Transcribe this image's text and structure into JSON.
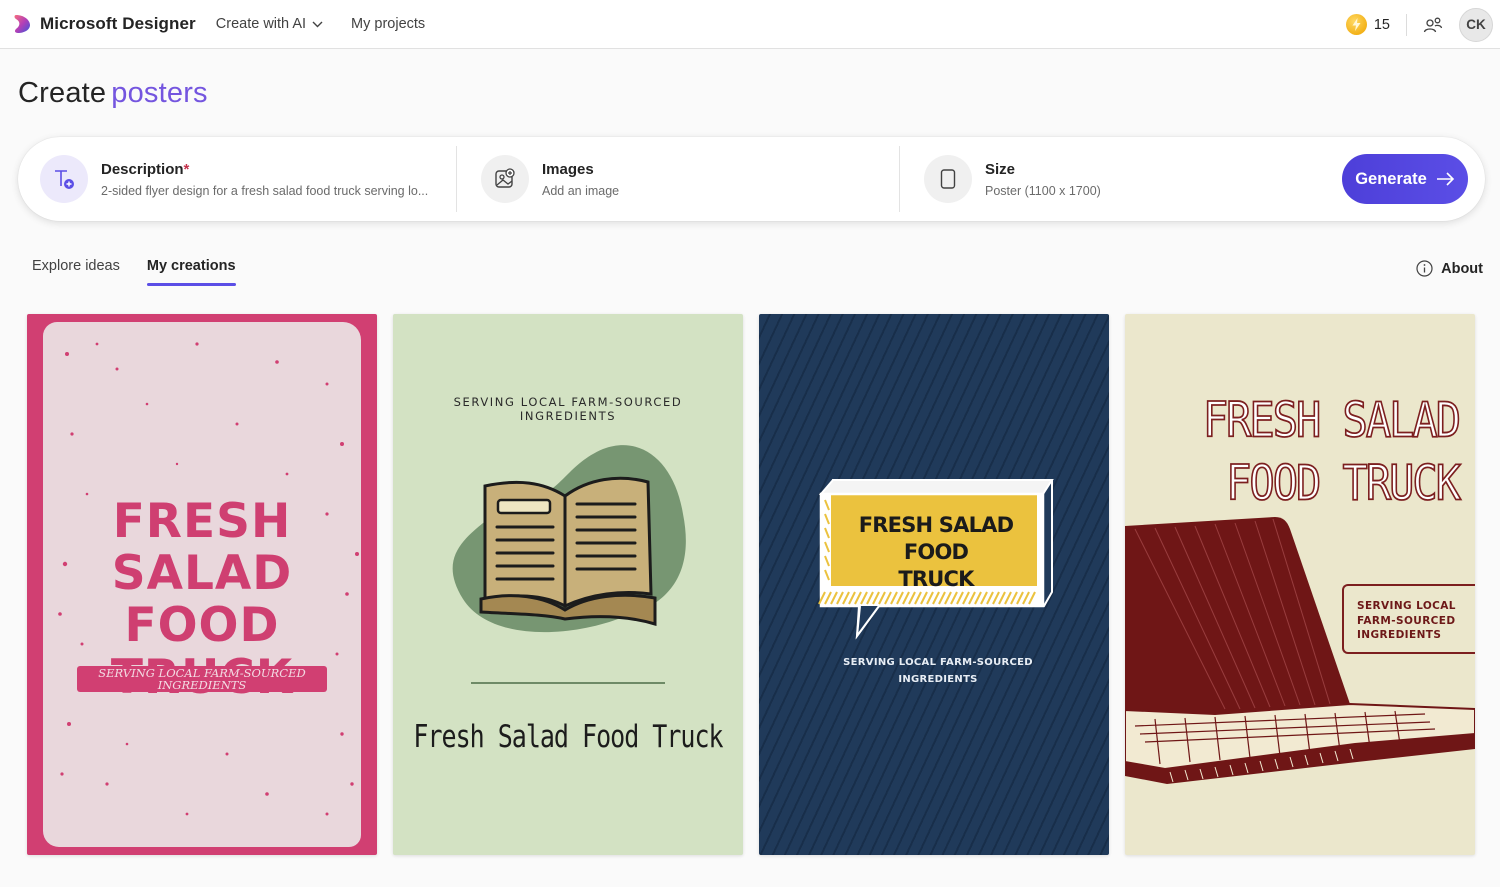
{
  "app": {
    "name": "Microsoft Designer",
    "nav": {
      "create_label": "Create with AI",
      "projects_label": "My projects"
    },
    "credits": "15",
    "avatar_initials": "CK"
  },
  "page": {
    "title_prefix": "Create",
    "title_accent": "posters"
  },
  "prompt": {
    "description": {
      "label": "Description",
      "required_mark": "*",
      "value": "2-sided flyer design for a fresh salad food truck serving lo..."
    },
    "images": {
      "label": "Images",
      "value": "Add an image"
    },
    "size": {
      "label": "Size",
      "value": "Poster (1100 x 1700)"
    },
    "generate_label": "Generate"
  },
  "tabs": [
    {
      "label": "Explore ideas",
      "active": false
    },
    {
      "label": "My creations",
      "active": true
    }
  ],
  "about_label": "About",
  "designs": [
    {
      "title": "FRESH SALAD FOOD TRUCK",
      "title_lines": [
        "FRESH",
        "SALAD FOOD",
        "TRUCK"
      ],
      "subtitle_lines": [
        "SERVING LOCAL FARM-SOURCED",
        "INGREDIENTS"
      ]
    },
    {
      "subtitle_lines": [
        "SERVING LOCAL FARM-SOURCED",
        "INGREDIENTS"
      ],
      "title": "Fresh Salad Food Truck"
    },
    {
      "title_lines": [
        "FRESH SALAD FOOD",
        "TRUCK"
      ],
      "subtitle_lines": [
        "SERVING LOCAL FARM-SOURCED",
        "INGREDIENTS"
      ]
    },
    {
      "title_lines": [
        "FRESH SALAD",
        "FOOD TRUCK"
      ],
      "subtitle_lines": [
        "SERVING LOCAL",
        "FARM-SOURCED",
        "INGREDIENTS"
      ]
    }
  ],
  "colors": {
    "accent": "#7455df",
    "generate": "#4f46d8",
    "card1_bg": "#d13f72",
    "card2_bg": "#d3e2c3",
    "card3_bg": "#203a5a",
    "card4_bg": "#ebe7cc"
  }
}
